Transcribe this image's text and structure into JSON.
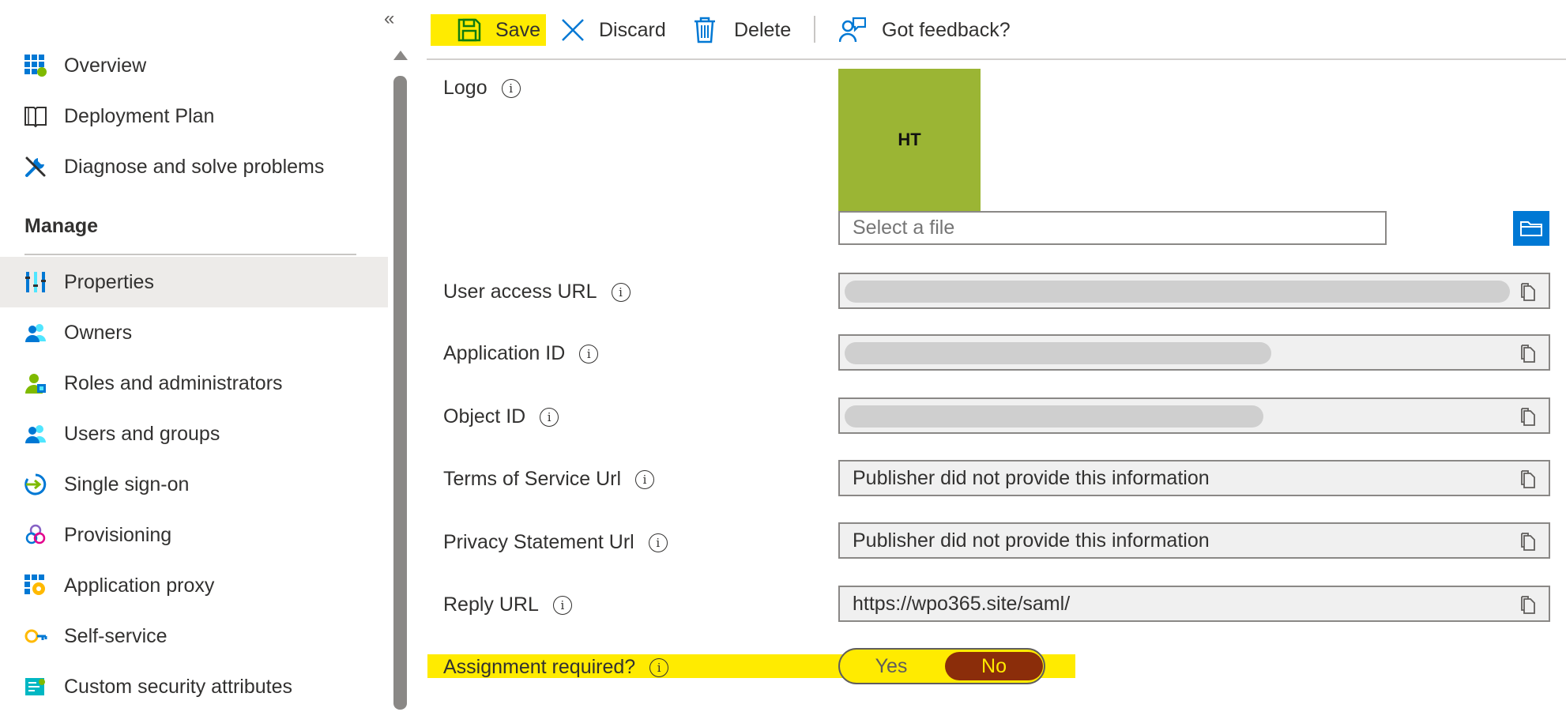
{
  "sidebar": {
    "collapse_glyph": "«",
    "items_top": [
      {
        "label": "Overview",
        "icon": "grid-icon"
      },
      {
        "label": "Deployment Plan",
        "icon": "book-icon"
      },
      {
        "label": "Diagnose and solve problems",
        "icon": "wrench-icon"
      }
    ],
    "section_heading": "Manage",
    "items_manage": [
      {
        "label": "Properties",
        "icon": "properties-icon",
        "active": true
      },
      {
        "label": "Owners",
        "icon": "people-icon"
      },
      {
        "label": "Roles and administrators",
        "icon": "roles-icon"
      },
      {
        "label": "Users and groups",
        "icon": "users-icon"
      },
      {
        "label": "Single sign-on",
        "icon": "sso-icon"
      },
      {
        "label": "Provisioning",
        "icon": "provisioning-icon"
      },
      {
        "label": "Application proxy",
        "icon": "app-proxy-icon"
      },
      {
        "label": "Self-service",
        "icon": "self-service-icon"
      },
      {
        "label": "Custom security attributes",
        "icon": "security-attributes-icon"
      }
    ]
  },
  "toolbar": {
    "save_label": "Save",
    "discard_label": "Discard",
    "delete_label": "Delete",
    "feedback_label": "Got feedback?"
  },
  "form": {
    "logo": {
      "label": "Logo",
      "initials": "HT",
      "file_placeholder": "Select a file"
    },
    "user_access_url": {
      "label": "User access URL"
    },
    "application_id": {
      "label": "Application ID"
    },
    "object_id": {
      "label": "Object ID"
    },
    "terms_of_service_url": {
      "label": "Terms of Service Url",
      "value": "Publisher did not provide this information"
    },
    "privacy_statement_url": {
      "label": "Privacy Statement Url",
      "value": "Publisher did not provide this information"
    },
    "reply_url": {
      "label": "Reply URL",
      "value": "https://wpo365.site/saml/"
    },
    "assignment_required": {
      "label": "Assignment required?",
      "yes": "Yes",
      "no": "No",
      "selected": "No"
    },
    "info_glyph": "i"
  },
  "colors": {
    "highlight": "#ffeb00",
    "accent": "#0078d4",
    "logo_tile": "#9bb534",
    "toggle_selected": "#8b2d0a"
  }
}
